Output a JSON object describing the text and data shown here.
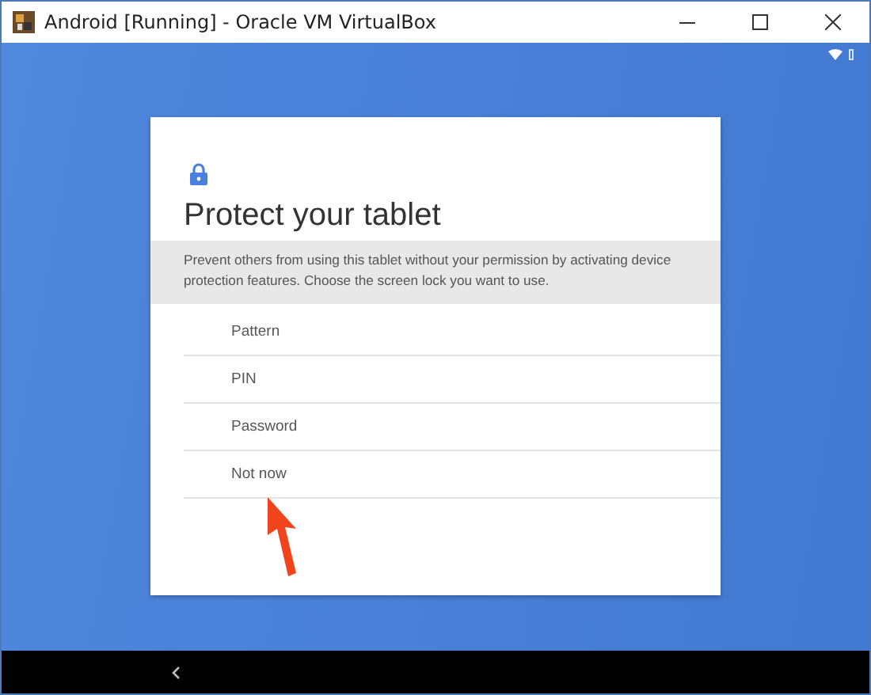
{
  "window": {
    "title": "Android [Running] - Oracle VM VirtualBox"
  },
  "dialog": {
    "title": "Protect your tablet",
    "description": "Prevent others from using this tablet without your permission by activating device protection features. Choose the screen lock you want to use.",
    "options": [
      {
        "label": "Pattern"
      },
      {
        "label": "PIN"
      },
      {
        "label": "Password"
      },
      {
        "label": "Not now"
      }
    ]
  }
}
